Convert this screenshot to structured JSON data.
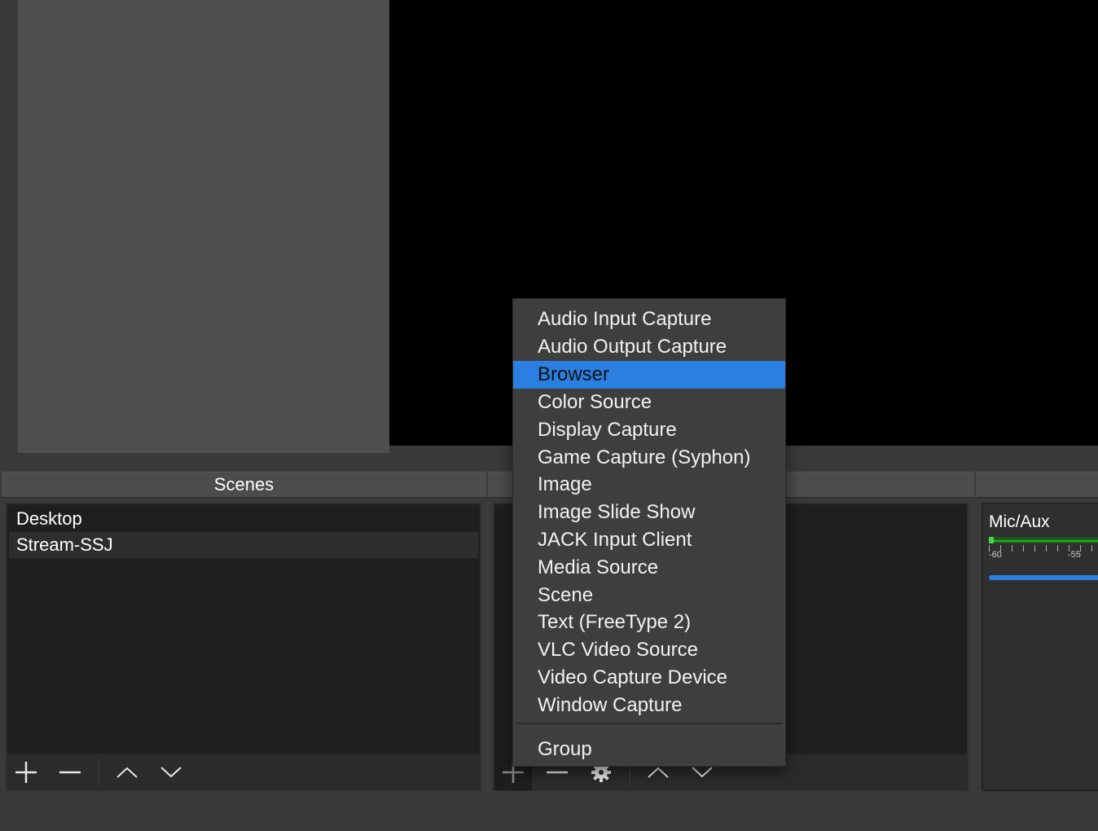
{
  "docks": {
    "scenes_title": "Scenes",
    "sources_title": ""
  },
  "scenes": [
    {
      "label": "Desktop",
      "selected": false
    },
    {
      "label": "Stream-SSJ",
      "selected": true
    }
  ],
  "icons": {
    "add": "plus-icon",
    "remove": "minus-icon",
    "properties": "gear-icon",
    "move_up": "chevron-up-icon",
    "move_down": "chevron-down-icon"
  },
  "mixer": {
    "source_label": "Mic/Aux",
    "scale_left": "-60",
    "scale_right": "-55",
    "volume_color": "#2b7fe0",
    "meter_color": "#2ea82e"
  },
  "context_menu": {
    "items": [
      "Audio Input Capture",
      "Audio Output Capture",
      "Browser",
      "Color Source",
      "Display Capture",
      "Game Capture (Syphon)",
      "Image",
      "Image Slide Show",
      "JACK Input Client",
      "Media Source",
      "Scene",
      "Text (FreeType 2)",
      "VLC Video Source",
      "Video Capture Device",
      "Window Capture"
    ],
    "highlighted": "Browser",
    "group_label": "Group",
    "highlight_color": "#2b7fe0"
  }
}
